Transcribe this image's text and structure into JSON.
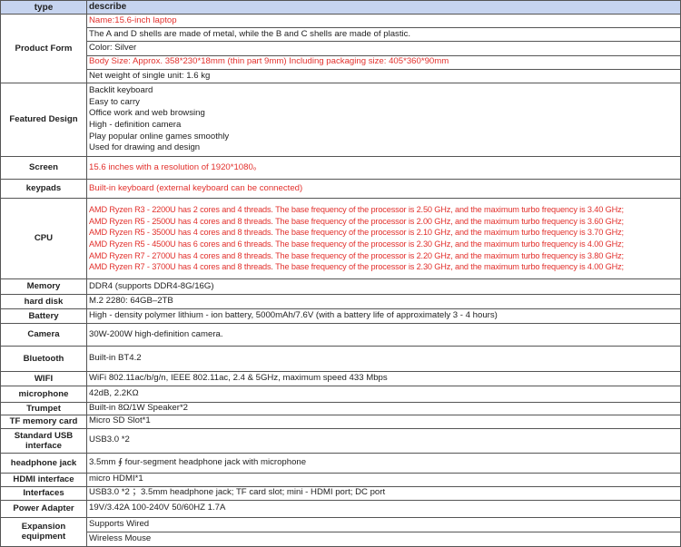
{
  "header": {
    "type": "type",
    "describe": "describe"
  },
  "colors": {
    "header_bg": "#c6d4ef",
    "highlight_text": "#e2302c"
  },
  "rows": [
    {
      "type": "Product Form",
      "lines": [
        {
          "text": "Name:15.6-inch laptop",
          "red": true
        },
        {
          "text": "The A and D shells are made of metal, while the B and C shells are made of plastic."
        },
        {
          "text": "Color: Silver"
        },
        {
          "text": "Body Size: Approx. 358*230*18mm (thin part 9mm) Including packaging size: 405*360*90mm",
          "red": true
        },
        {
          "text": "Net weight of single unit: 1.6 kg"
        }
      ],
      "split": true
    },
    {
      "type": "Featured Design",
      "lines": [
        {
          "text": "Backlit keyboard"
        },
        {
          "text": "Easy to carry"
        },
        {
          "text": "Office work and web browsing"
        },
        {
          "text": "High - definition camera"
        },
        {
          "text": "Play popular online games smoothly"
        },
        {
          "text": "Used for drawing and design"
        }
      ]
    },
    {
      "type": "Screen",
      "lines": [
        {
          "text": "15.6 inches with a resolution of 1920*1080。",
          "red": true
        }
      ]
    },
    {
      "type": "keypads",
      "lines": [
        {
          "text": "Built-in keyboard (external keyboard can be connected)",
          "red": true
        }
      ]
    },
    {
      "type": "CPU",
      "cpu": true,
      "lines": [
        {
          "text": "AMD Ryzen R3 - 2200U has 2 cores and 4 threads. The base frequency of the processor is 2.50 GHz, and the maximum turbo frequency is 3.40 GHz;",
          "red": true
        },
        {
          "text": "AMD Ryzen R5 - 2500U has 4 cores and 8 threads. The base frequency of the processor is 2.00 GHz, and the maximum turbo frequency is 3.60 GHz;",
          "red": true
        },
        {
          "text": "AMD Ryzen R5 - 3500U has 4 cores and 8 threads. The base frequency of the processor is 2.10 GHz, and the maximum turbo frequency is 3.70 GHz;",
          "red": true
        },
        {
          "text": "AMD Ryzen R5 - 4500U has 6 cores and 6 threads. The base frequency of the processor is 2.30 GHz, and the maximum turbo frequency is 4.00 GHz;",
          "red": true
        },
        {
          "text": "AMD Ryzen R7 - 2700U has 4 cores and 8 threads. The base frequency of the processor is 2.20 GHz, and the maximum turbo frequency is 3.80 GHz;",
          "red": true
        },
        {
          "text": "AMD Ryzen R7 - 3700U has 4 cores and 8 threads. The base frequency of the processor is 2.30 GHz, and the maximum turbo frequency is 4.00 GHz;",
          "red": true
        }
      ]
    },
    {
      "type": "Memory",
      "lines": [
        {
          "text": "DDR4 (supports DDR4-8G/16G)"
        }
      ]
    },
    {
      "type": "hard disk",
      "lines": [
        {
          "text": " M.2 2280: 64GB–2TB"
        }
      ]
    },
    {
      "type": "Battery",
      "lines": [
        {
          "text": "High - density polymer lithium - ion battery, 5000mAh/7.6V (with a battery life of approximately 3 - 4 hours)"
        }
      ]
    },
    {
      "type": "Camera",
      "lines": [
        {
          "text": "30W-200W high-definition camera."
        }
      ]
    },
    {
      "type": "Bluetooth",
      "lines": [
        {
          "text": "Built-in BT4.2"
        }
      ]
    },
    {
      "type": "WIFI",
      "lines": [
        {
          "text": "WiFi 802.11ac/b/g/n, IEEE 802.11ac, 2.4 & 5GHz, maximum speed 433 Mbps"
        }
      ]
    },
    {
      "type": "microphone",
      "lines": [
        {
          "text": "42dB, 2.2KΩ"
        }
      ]
    },
    {
      "type": "Trumpet",
      "lines": [
        {
          "text": "Built-in 8Ω/1W Speaker*2"
        }
      ]
    },
    {
      "type": "TF memory card",
      "lines": [
        {
          "text": "Micro SD Slot*1"
        }
      ]
    },
    {
      "type": "Standard USB interface",
      "lines": [
        {
          "text": " USB3.0 *2"
        }
      ]
    },
    {
      "type": "headphone jack",
      "lines": [
        {
          "text": "3.5mm ∮ four-segment headphone jack with microphone"
        }
      ]
    },
    {
      "type": "HDMI interface",
      "lines": [
        {
          "text": " micro HDMI*1"
        }
      ]
    },
    {
      "type": "Interfaces",
      "lines": [
        {
          "text": " USB3.0 *2 ；3.5mm headphone jack; TF card slot; mini - HDMI port; DC port"
        }
      ]
    },
    {
      "type": "Power Adapter",
      "lines": [
        {
          "text": "19V/3.42A 100-240V 50/60HZ 1.7A"
        }
      ]
    },
    {
      "type": "Expansion equipment",
      "lines": [
        {
          "text": " Supports Wired"
        },
        {
          "text": "Wireless Mouse"
        }
      ],
      "split": true
    }
  ]
}
